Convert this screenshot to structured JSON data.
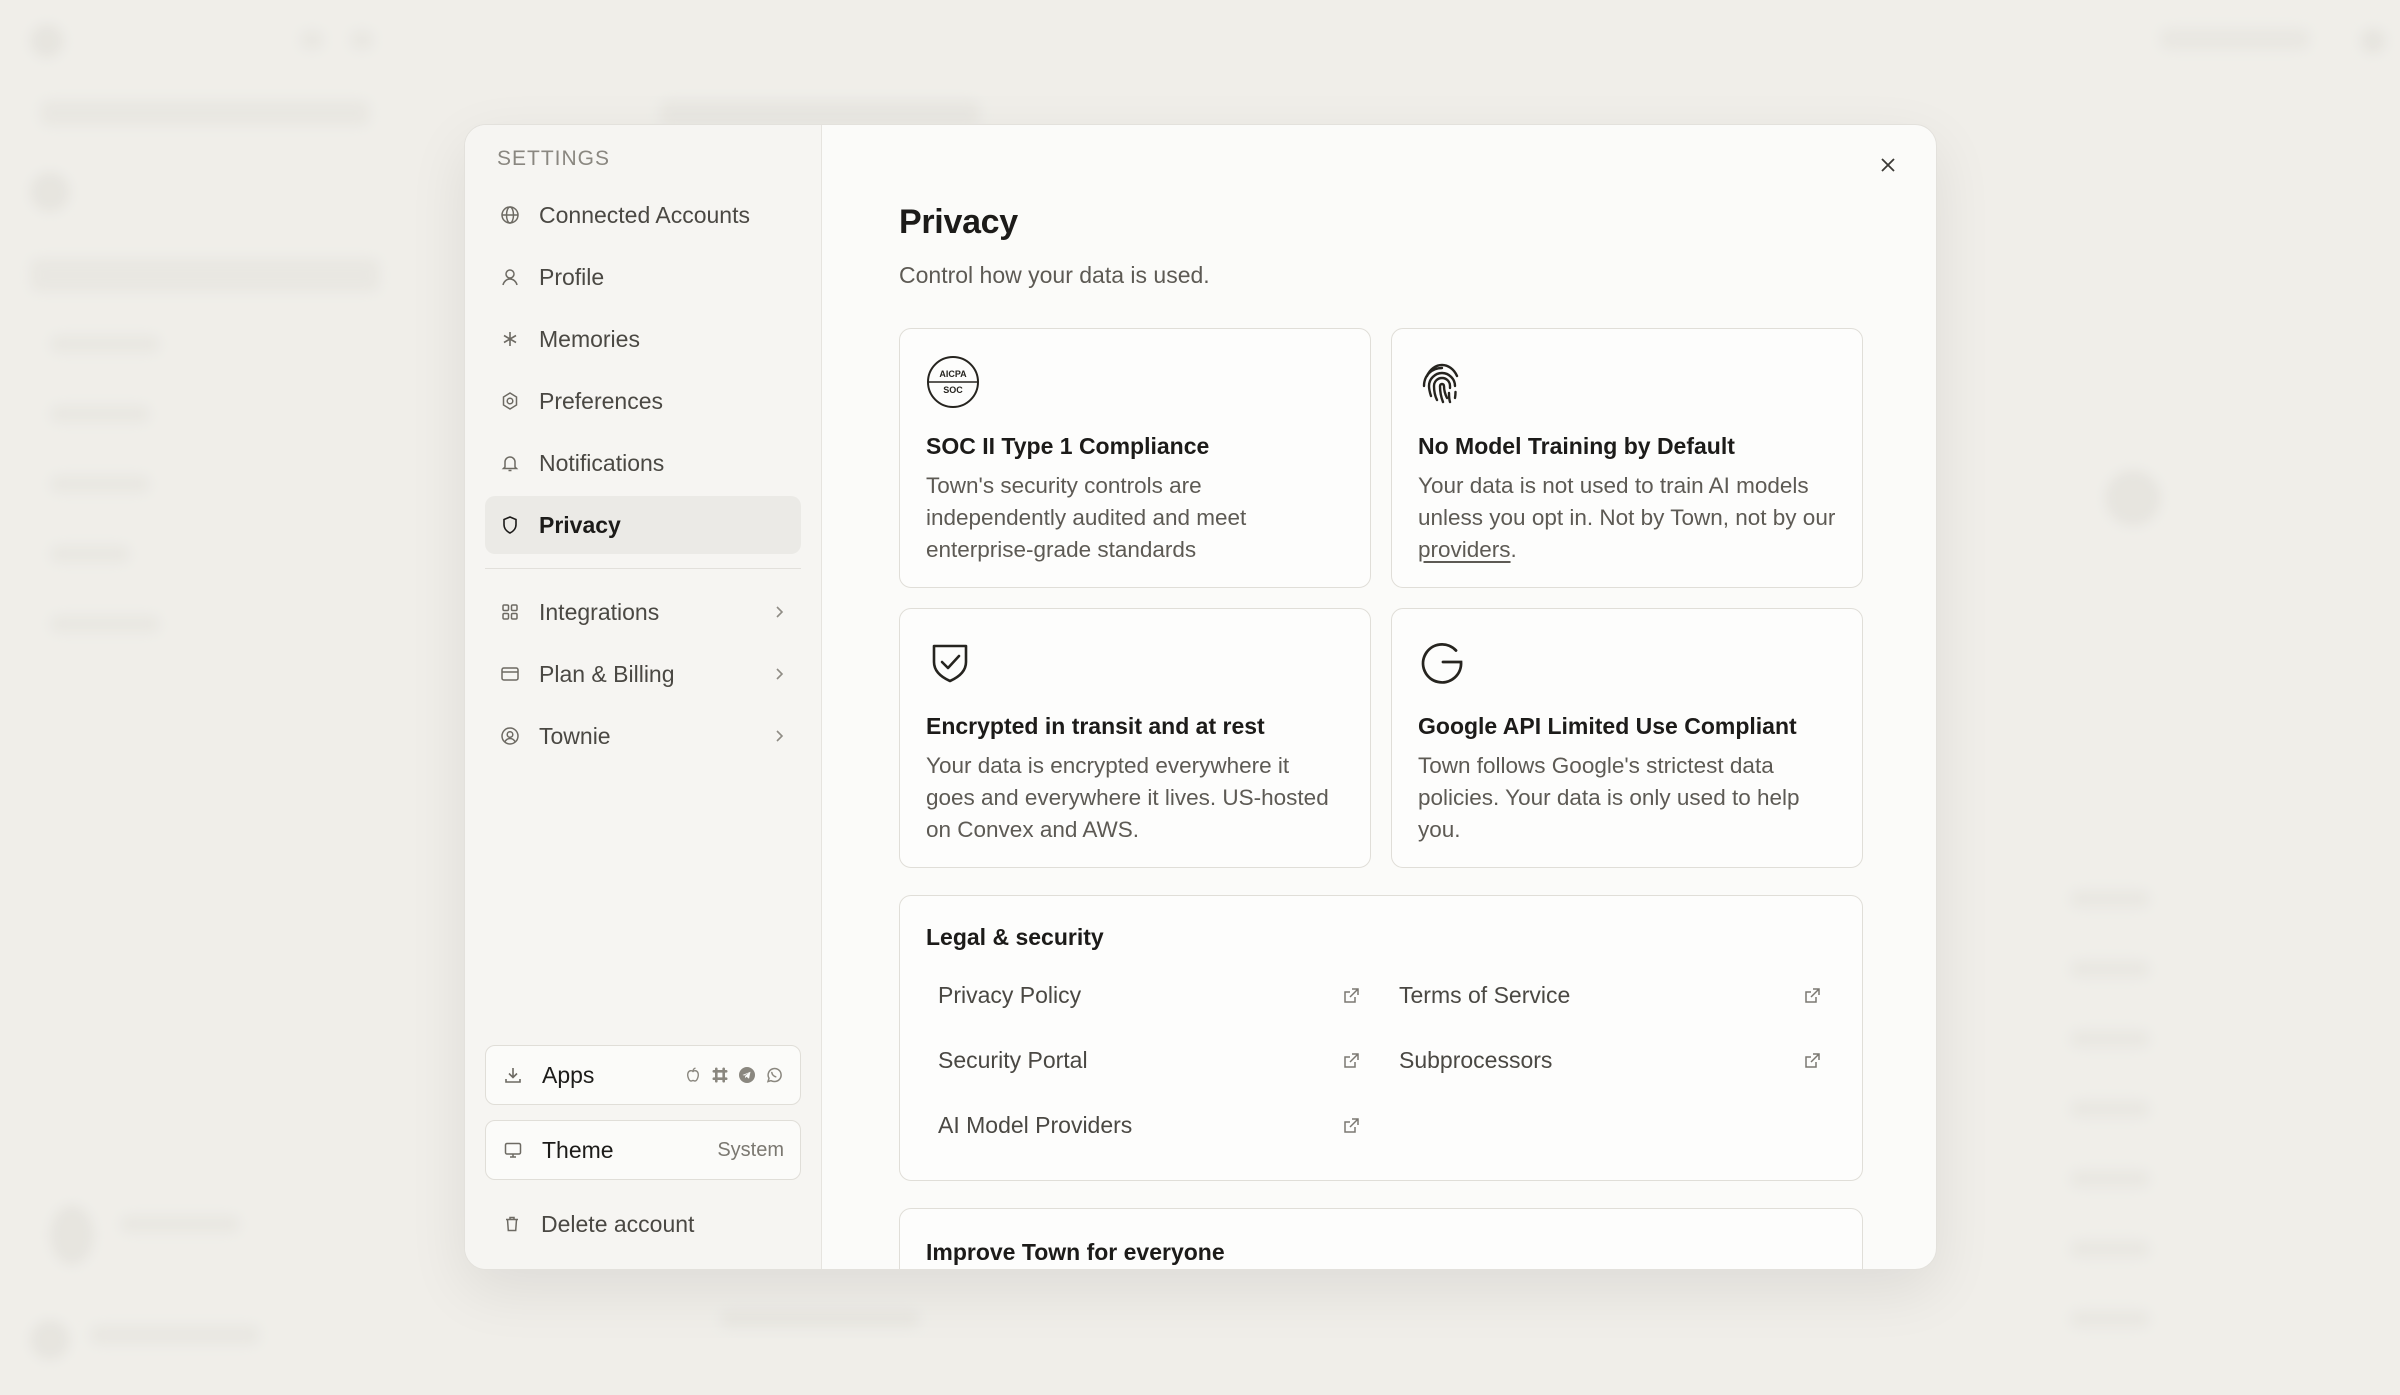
{
  "sidebar": {
    "heading": "SETTINGS",
    "items": [
      {
        "label": "Connected Accounts",
        "icon": "globe-icon"
      },
      {
        "label": "Profile",
        "icon": "user-icon"
      },
      {
        "label": "Memories",
        "icon": "asterisk-icon"
      },
      {
        "label": "Preferences",
        "icon": "gear-icon"
      },
      {
        "label": "Notifications",
        "icon": "bell-icon"
      },
      {
        "label": "Privacy",
        "icon": "shield-icon",
        "active": true
      }
    ],
    "more_items": [
      {
        "label": "Integrations",
        "icon": "grid-icon"
      },
      {
        "label": "Plan & Billing",
        "icon": "card-icon"
      },
      {
        "label": "Townie",
        "icon": "user-circle-icon"
      }
    ],
    "apps": {
      "label": "Apps",
      "icons": [
        "apple-icon",
        "slack-icon",
        "telegram-icon",
        "whatsapp-icon"
      ]
    },
    "theme": {
      "label": "Theme",
      "value": "System"
    },
    "delete": {
      "label": "Delete account"
    }
  },
  "main": {
    "title": "Privacy",
    "subtitle": "Control how your data is used.",
    "cards": [
      {
        "title": "SOC II Type 1 Compliance",
        "text": "Town's security controls are independently audited and meet enterprise-grade standards",
        "badge_top": "AICPA",
        "badge_bottom": "SOC"
      },
      {
        "title": "No Model Training by Default",
        "text_before": "Your data is not used to train AI models unless you opt in. Not by Town, not by our ",
        "link": "providers",
        "text_after": "."
      },
      {
        "title": "Encrypted in transit and at rest",
        "text": "Your data is encrypted everywhere it goes and everywhere it lives. US-hosted on Convex and AWS."
      },
      {
        "title": "Google API Limited Use Compliant",
        "text": "Town follows Google's strictest data policies. Your data is only used to help you."
      }
    ],
    "legal": {
      "title": "Legal & security",
      "links": [
        "Privacy Policy",
        "Terms of Service",
        "Security Portal",
        "Subprocessors",
        "AI Model Providers"
      ]
    },
    "improve": {
      "title": "Improve Town for everyone"
    }
  }
}
